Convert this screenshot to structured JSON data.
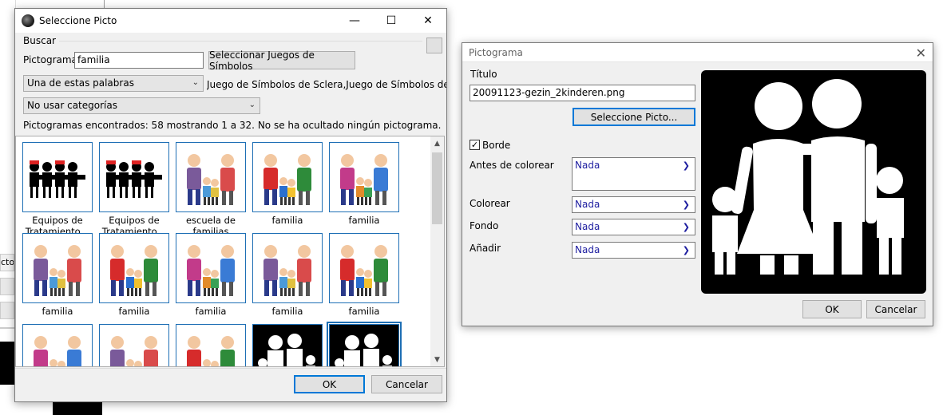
{
  "background": {
    "left_tab": "ctog"
  },
  "search_window": {
    "title": "Seleccione Picto",
    "buscar_label": "Buscar",
    "pictograma_label": "Pictograma",
    "search_value": "familia",
    "select_sets_label": "Seleccionar Juegos de Símbolos",
    "match_mode": "Una de estas palabras",
    "symbol_sets_text": "Juego de Símbolos de Sclera,Juego de Símbolos de Mu",
    "category": "No usar categorías",
    "results_text": "Pictogramas encontrados: 58 mostrando 1 a 32. No se ha ocultado ningún pictograma.",
    "ok_label": "OK",
    "cancel_label": "Cancelar",
    "results": [
      {
        "label": "Equipos de Tratamiento…",
        "style": "sclera"
      },
      {
        "label": "Equipos de Tratamiento…",
        "style": "sclera"
      },
      {
        "label": "escuela de familias",
        "style": "color"
      },
      {
        "label": "familia",
        "style": "color"
      },
      {
        "label": "familia",
        "style": "photo"
      },
      {
        "label": "familia",
        "style": "photo"
      },
      {
        "label": "familia",
        "style": "color"
      },
      {
        "label": "familia",
        "style": "color"
      },
      {
        "label": "familia",
        "style": "color"
      },
      {
        "label": "familia",
        "style": "color"
      },
      {
        "label": "",
        "style": "color"
      },
      {
        "label": "",
        "style": "color"
      },
      {
        "label": "",
        "style": "color"
      },
      {
        "label": "",
        "style": "dark"
      },
      {
        "label": "",
        "style": "dark"
      }
    ]
  },
  "picto_window": {
    "title": "Pictograma",
    "titulo_label": "Título",
    "titulo_value": "20091123-gezin_2kinderen.png",
    "select_picto_label": "Seleccione Picto...",
    "borde_label": "Borde",
    "borde_checked": "✓",
    "antes_label": "Antes de colorear",
    "antes_value": "Nada",
    "colorear_label": "Colorear",
    "colorear_value": "Nada",
    "fondo_label": "Fondo",
    "fondo_value": "Nada",
    "anadir_label": "Añadir",
    "anadir_value": "Nada",
    "ok_label": "OK",
    "cancel_label": "Cancelar"
  },
  "colors": {
    "accent": "#0078d7",
    "thumb_border": "#1e6fb5",
    "dropdown_text": "#1e1ea0"
  }
}
